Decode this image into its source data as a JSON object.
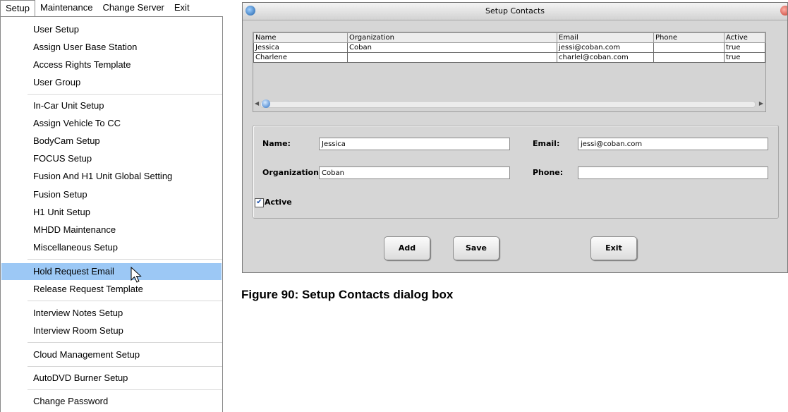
{
  "menubar": {
    "items": [
      "Setup",
      "Maintenance",
      "Change Server",
      "Exit"
    ]
  },
  "setup_menu": {
    "items": [
      "User Setup",
      "Assign User Base Station",
      "Access Rights Template",
      "User Group",
      "In-Car Unit Setup",
      "Assign Vehicle To CC",
      "BodyCam Setup",
      "FOCUS Setup",
      "Fusion And H1 Unit Global Setting",
      "Fusion Setup",
      "H1 Unit Setup",
      "MHDD Maintenance",
      "Miscellaneous Setup",
      "Hold Request Email",
      "Release Request Template",
      "Interview Notes Setup",
      "Interview Room Setup",
      "Cloud Management Setup",
      "AutoDVD Burner Setup",
      "Change Password"
    ],
    "highlighted": "Hold Request Email"
  },
  "dialog": {
    "title": "Setup Contacts",
    "grid": {
      "columns": [
        "Name",
        "Organization",
        "Email",
        "Phone",
        "Active"
      ],
      "rows": [
        [
          "Jessica",
          "Coban",
          "jessi@coban.com",
          "",
          "true"
        ],
        [
          "Charlene",
          "",
          "charlel@coban.com",
          "",
          "true"
        ]
      ]
    },
    "form": {
      "name_label": "Name:",
      "name_value": "Jessica",
      "email_label": "Email:",
      "email_value": "jessi@coban.com",
      "org_label": "Organization:",
      "org_value": "Coban",
      "phone_label": "Phone:",
      "phone_value": "",
      "active_label": "Active",
      "active_checked": true
    },
    "buttons": {
      "add": "Add",
      "save": "Save",
      "exit": "Exit"
    }
  },
  "caption": "Figure 90: Setup Contacts dialog box"
}
